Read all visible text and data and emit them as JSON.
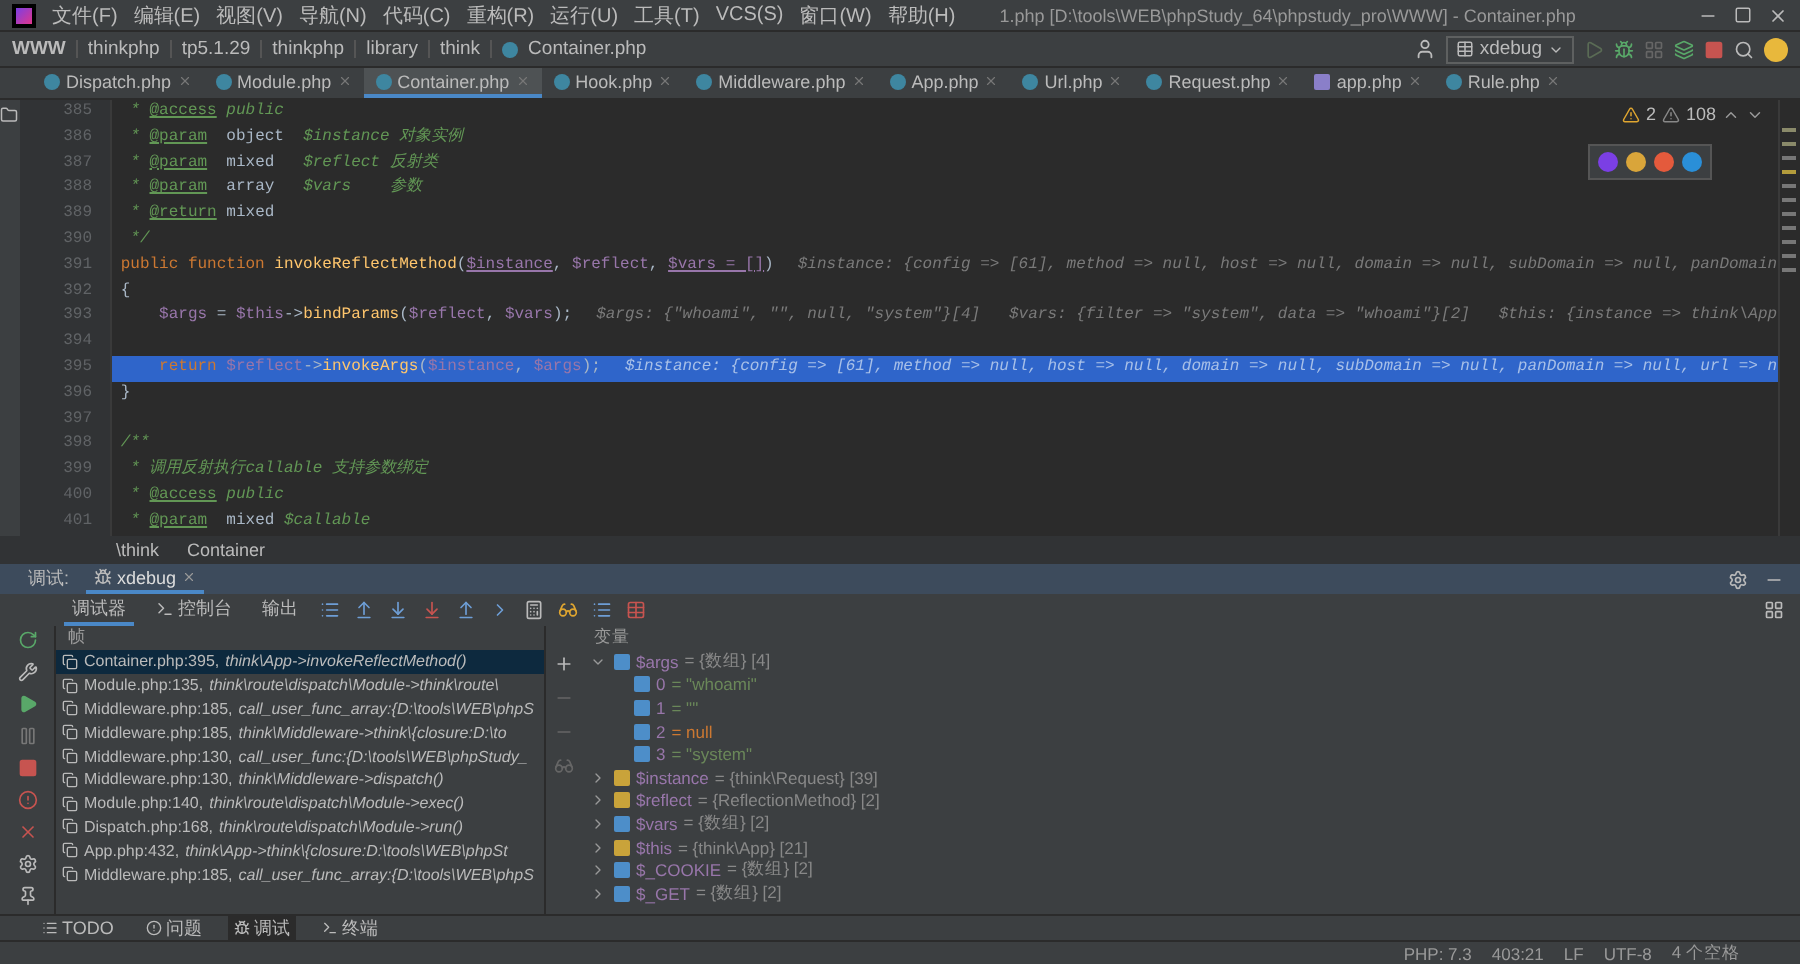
{
  "title_bar": {
    "menus": [
      "文件(F)",
      "编辑(E)",
      "视图(V)",
      "导航(N)",
      "代码(C)",
      "重构(R)",
      "运行(U)",
      "工具(T)",
      "VCS(S)",
      "窗口(W)",
      "帮助(H)"
    ],
    "title": "1.php [D:\\tools\\WEB\\phpStudy_64\\phpstudy_pro\\WWW] - Container.php"
  },
  "nav_bar": {
    "breadcrumb": [
      "WWW",
      "thinkphp",
      "tp5.1.29",
      "thinkphp",
      "library",
      "think",
      "Container.php"
    ],
    "run_config": "xdebug"
  },
  "tabs": [
    {
      "label": "Dispatch.php",
      "selected": false,
      "kind": "class"
    },
    {
      "label": "Module.php",
      "selected": false,
      "kind": "class"
    },
    {
      "label": "Container.php",
      "selected": true,
      "kind": "class"
    },
    {
      "label": "Hook.php",
      "selected": false,
      "kind": "class"
    },
    {
      "label": "Middleware.php",
      "selected": false,
      "kind": "class"
    },
    {
      "label": "App.php",
      "selected": false,
      "kind": "class"
    },
    {
      "label": "Url.php",
      "selected": false,
      "kind": "class"
    },
    {
      "label": "Request.php",
      "selected": false,
      "kind": "class"
    },
    {
      "label": "app.php",
      "selected": false,
      "kind": "config"
    },
    {
      "label": "Rule.php",
      "selected": false,
      "kind": "class"
    }
  ],
  "editor": {
    "warnings": "2",
    "weak_warnings": "108",
    "lines": [
      {
        "number": "385",
        "current": false,
        "tokens": [
          {
            "kind": "comment",
            "text": " * "
          },
          {
            "kind": "doctag",
            "text": "@access"
          },
          {
            "kind": "comment",
            "text": " public"
          }
        ]
      },
      {
        "number": "386",
        "current": false,
        "tokens": [
          {
            "kind": "comment",
            "text": " * "
          },
          {
            "kind": "doctag",
            "text": "@param"
          },
          {
            "kind": "type",
            "text": "  object  "
          },
          {
            "kind": "comment",
            "text": "$instance 对象实例"
          }
        ]
      },
      {
        "number": "387",
        "current": false,
        "tokens": [
          {
            "kind": "comment",
            "text": " * "
          },
          {
            "kind": "doctag",
            "text": "@param"
          },
          {
            "kind": "type",
            "text": "  mixed   "
          },
          {
            "kind": "comment",
            "text": "$reflect 反射类"
          }
        ]
      },
      {
        "number": "388",
        "current": false,
        "tokens": [
          {
            "kind": "comment",
            "text": " * "
          },
          {
            "kind": "doctag",
            "text": "@param"
          },
          {
            "kind": "type",
            "text": "  array   "
          },
          {
            "kind": "comment",
            "text": "$vars    参数"
          }
        ]
      },
      {
        "number": "389",
        "current": false,
        "tokens": [
          {
            "kind": "comment",
            "text": " * "
          },
          {
            "kind": "doctag",
            "text": "@return"
          },
          {
            "kind": "type",
            "text": " mixed"
          }
        ]
      },
      {
        "number": "390",
        "current": false,
        "tokens": [
          {
            "kind": "comment",
            "text": " */"
          }
        ]
      },
      {
        "number": "391",
        "current": false,
        "tokens": [
          {
            "kind": "keyword",
            "text": "public function "
          },
          {
            "kind": "fn",
            "text": "invokeReflectMethod"
          },
          {
            "kind": "plain",
            "text": "("
          },
          {
            "kind": "param",
            "text": "$instance"
          },
          {
            "kind": "plain",
            "text": ", "
          },
          {
            "kind": "var",
            "text": "$reflect"
          },
          {
            "kind": "plain",
            "text": ", "
          },
          {
            "kind": "param",
            "text": "$vars = []"
          },
          {
            "kind": "plain",
            "text": ")"
          }
        ],
        "hint": "$instance: {config => [61], method => null, host => null, domain => null, subDomain => null, panDomain"
      },
      {
        "number": "392",
        "current": false,
        "tokens": [
          {
            "kind": "plain",
            "text": "{"
          }
        ]
      },
      {
        "number": "393",
        "current": false,
        "tokens": [
          {
            "kind": "var",
            "text": "    $args"
          },
          {
            "kind": "plain",
            "text": " = "
          },
          {
            "kind": "var",
            "text": "$this"
          },
          {
            "kind": "plain",
            "text": "->"
          },
          {
            "kind": "fn",
            "text": "bindParams"
          },
          {
            "kind": "plain",
            "text": "("
          },
          {
            "kind": "var",
            "text": "$reflect"
          },
          {
            "kind": "plain",
            "text": ", "
          },
          {
            "kind": "var",
            "text": "$vars"
          },
          {
            "kind": "plain",
            "text": ");"
          }
        ],
        "hint": "$args: {\"whoami\", \"\", null, \"system\"}[4]   $vars: {filter => \"system\", data => \"whoami\"}[2]   $this: {instance => think\\App"
      },
      {
        "number": "394",
        "current": false
      },
      {
        "number": "395",
        "current": true,
        "tokens": [
          {
            "kind": "keyword",
            "text": "    return "
          },
          {
            "kind": "var",
            "text": "$reflect"
          },
          {
            "kind": "plain",
            "text": "->"
          },
          {
            "kind": "fn",
            "text": "invokeArgs"
          },
          {
            "kind": "plain",
            "text": "("
          },
          {
            "kind": "var",
            "text": "$instance"
          },
          {
            "kind": "plain",
            "text": ", "
          },
          {
            "kind": "var",
            "text": "$args"
          },
          {
            "kind": "plain",
            "text": ");"
          }
        ],
        "hint": "$instance: {config => [61], method => null, host => null, domain => null, subDomain => null, panDomain => null, url => n"
      },
      {
        "number": "396",
        "current": false,
        "tokens": [
          {
            "kind": "plain",
            "text": "}"
          }
        ]
      },
      {
        "number": "397",
        "current": false
      },
      {
        "number": "398",
        "current": false,
        "tokens": [
          {
            "kind": "comment",
            "text": "/**"
          }
        ]
      },
      {
        "number": "399",
        "current": false,
        "tokens": [
          {
            "kind": "comment",
            "text": " * 调用反射执行callable 支持参数绑定"
          }
        ]
      },
      {
        "number": "400",
        "current": false,
        "tokens": [
          {
            "kind": "comment",
            "text": " * "
          },
          {
            "kind": "doctag",
            "text": "@access"
          },
          {
            "kind": "comment",
            "text": " public"
          }
        ]
      },
      {
        "number": "401",
        "current": false,
        "tokens": [
          {
            "kind": "comment",
            "text": " * "
          },
          {
            "kind": "doctag",
            "text": "@param"
          },
          {
            "kind": "type",
            "text": "  mixed "
          },
          {
            "kind": "comment",
            "text": "$callable"
          }
        ]
      }
    ],
    "breadcrumb": [
      "\\think",
      "Container"
    ]
  },
  "debug": {
    "label": "调试:",
    "session": "xdebug",
    "tabs": [
      {
        "label": "调试器",
        "selected": true
      },
      {
        "label": "控制台",
        "selected": false
      },
      {
        "label": "输出",
        "selected": false
      }
    ],
    "frames_header": "帧",
    "frames": [
      {
        "file": "Container.php:395,",
        "method": "think\\App->invokeReflectMethod()",
        "selected": true
      },
      {
        "file": "Module.php:135,",
        "method": "think\\route\\dispatch\\Module->think\\route\\",
        "selected": false
      },
      {
        "file": "Middleware.php:185,",
        "method": "call_user_func_array:{D:\\tools\\WEB\\phpS",
        "selected": false
      },
      {
        "file": "Middleware.php:185,",
        "method": "think\\Middleware->think\\{closure:D:\\to",
        "selected": false
      },
      {
        "file": "Middleware.php:130,",
        "method": "call_user_func:{D:\\tools\\WEB\\phpStudy_",
        "selected": false
      },
      {
        "file": "Middleware.php:130,",
        "method": "think\\Middleware->dispatch()",
        "selected": false
      },
      {
        "file": "Module.php:140,",
        "method": "think\\route\\dispatch\\Module->exec()",
        "selected": false
      },
      {
        "file": "Dispatch.php:168,",
        "method": "think\\route\\dispatch\\Module->run()",
        "selected": false
      },
      {
        "file": "App.php:432,",
        "method": "think\\App->think\\{closure:D:\\tools\\WEB\\phpSt",
        "selected": false
      },
      {
        "file": "Middleware.php:185,",
        "method": "call_user_func_array:{D:\\tools\\WEB\\phpS",
        "selected": false
      }
    ],
    "variables_header": "变量",
    "variables": [
      {
        "name": "$args",
        "value": "= {数组} [4]",
        "kind": "array",
        "expanded": true,
        "children": [
          {
            "name": "0",
            "value": "= \"whoami\"",
            "kind": "string"
          },
          {
            "name": "1",
            "value": "= \"\"",
            "kind": "string"
          },
          {
            "name": "2",
            "value": "= null",
            "kind": "null"
          },
          {
            "name": "3",
            "value": "= \"system\"",
            "kind": "string"
          }
        ]
      },
      {
        "name": "$instance",
        "value": "= {think\\Request} [39]",
        "kind": "object",
        "expanded": false
      },
      {
        "name": "$reflect",
        "value": "= {ReflectionMethod} [2]",
        "kind": "object",
        "expanded": false
      },
      {
        "name": "$vars",
        "value": "= {数组} [2]",
        "kind": "array",
        "expanded": false
      },
      {
        "name": "$this",
        "value": "= {think\\App} [21]",
        "kind": "object",
        "expanded": false
      },
      {
        "name": "$_COOKIE",
        "value": "= {数组} [2]",
        "kind": "array",
        "expanded": false
      },
      {
        "name": "$_GET",
        "value": "= {数组} [2]",
        "kind": "array",
        "expanded": false
      }
    ]
  },
  "tool_windows": [
    {
      "label": "TODO",
      "selected": false
    },
    {
      "label": "问题",
      "selected": false
    },
    {
      "label": "调试",
      "selected": true
    },
    {
      "label": "终端",
      "selected": false
    }
  ],
  "status_bar": [
    "PHP: 7.3",
    "403:21",
    "LF",
    "UTF-8",
    "4 个空格"
  ]
}
